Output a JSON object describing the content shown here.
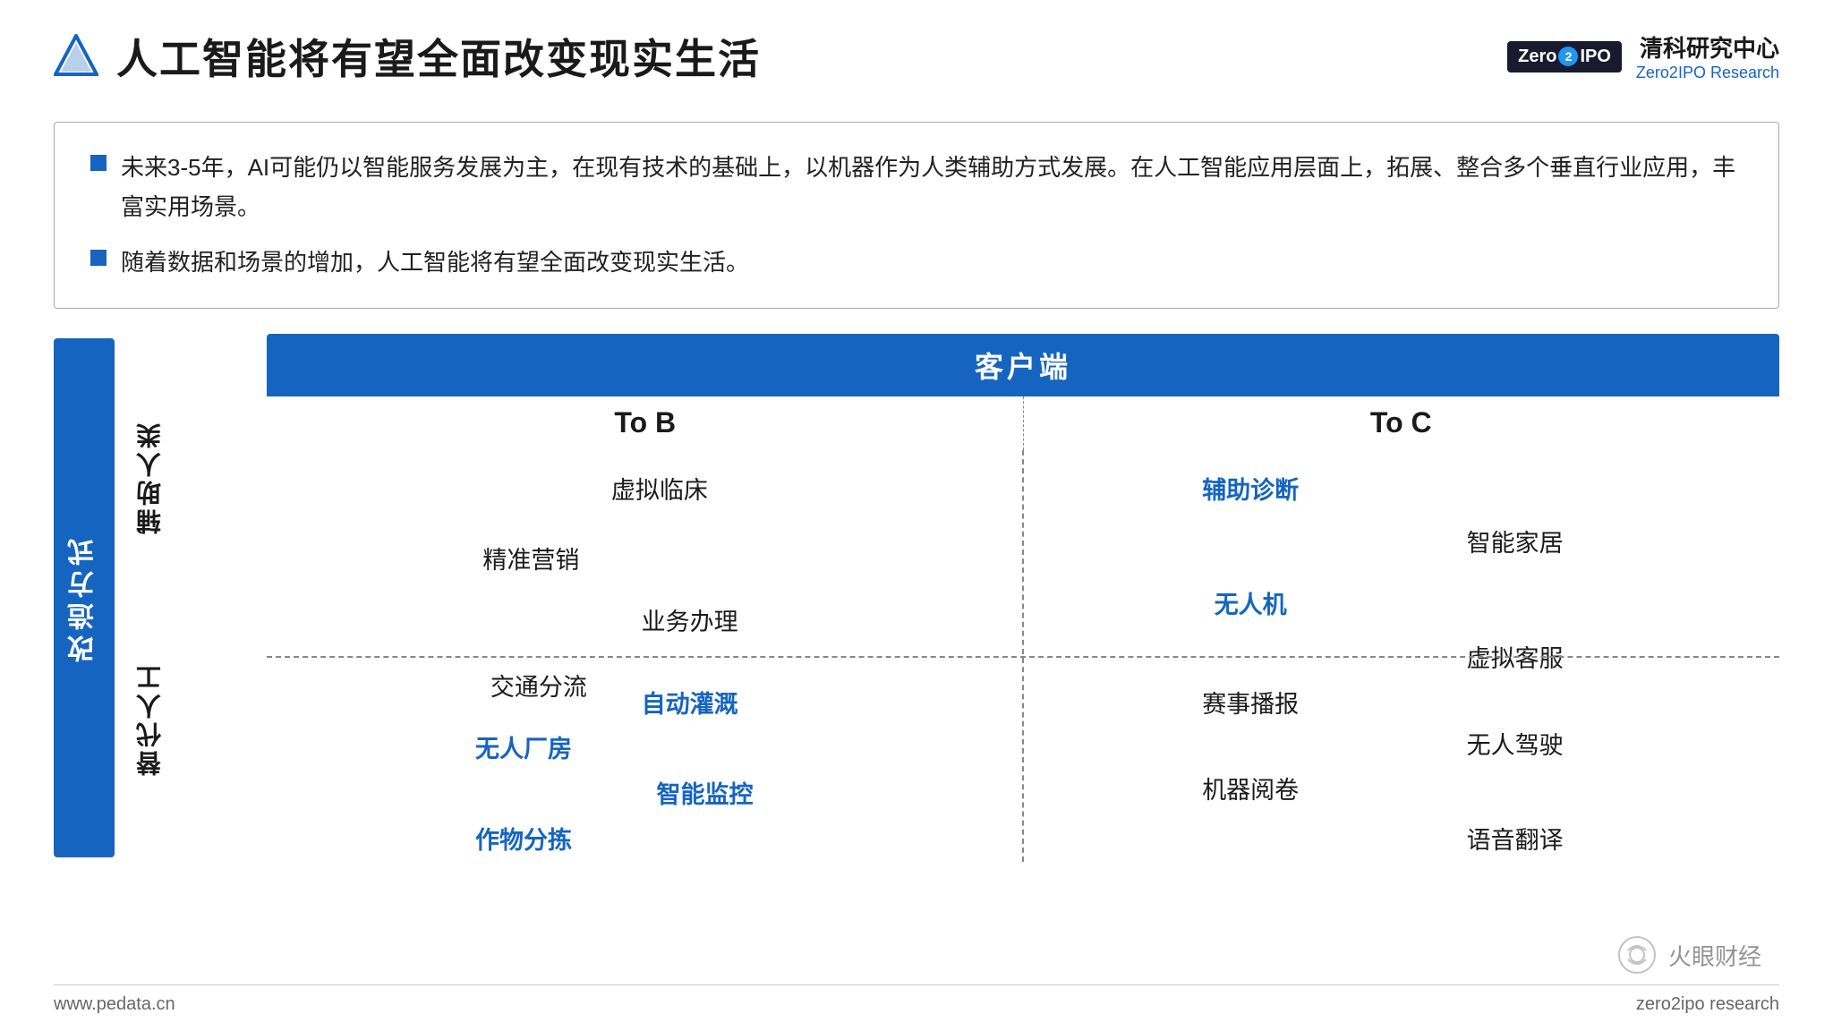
{
  "header": {
    "title": "人工智能将有望全面改变现实生活",
    "logo_text": "Zero2IPO",
    "org_cn": "清科研究中心",
    "org_en": "Zero2IPO Research"
  },
  "bullets": [
    "未来3-5年，AI可能仍以智能服务发展为主，在现有技术的基础上，以机器作为人类辅助方式发展。在人工智能应用层面上，拓展、整合多个垂直行业应用，丰富实用场景。",
    "随着数据和场景的增加，人工智能将有望全面改变现实生活。"
  ],
  "matrix": {
    "customer_header": "客户端",
    "left_axis_label": "改造方式",
    "row_labels": [
      "辅助人类",
      "替代人工"
    ],
    "col_labels": [
      "To  B",
      "To  C"
    ],
    "items": {
      "top_left": [
        {
          "text": "虚拟临床",
          "left": "52%",
          "top": "6%",
          "blue": false
        },
        {
          "text": "精准营销",
          "left": "32%",
          "top": "22%",
          "blue": false
        },
        {
          "text": "业务办理",
          "left": "55%",
          "top": "38%",
          "blue": false
        },
        {
          "text": "交通分流",
          "left": "38%",
          "top": "54%",
          "blue": false
        }
      ],
      "top_right": [
        {
          "text": "辅助诊断",
          "left": "28%",
          "top": "6%",
          "blue": true
        },
        {
          "text": "智能家居",
          "left": "60%",
          "top": "19%",
          "blue": false
        },
        {
          "text": "无人机",
          "left": "28%",
          "top": "33%",
          "blue": true
        },
        {
          "text": "虚拟客服",
          "left": "62%",
          "top": "47%",
          "blue": false
        }
      ],
      "bottom_left": [
        {
          "text": "自动灌溉",
          "left": "55%",
          "top": "8%",
          "blue": true
        },
        {
          "text": "无人厂房",
          "left": "33%",
          "top": "26%",
          "blue": true
        },
        {
          "text": "智能监控",
          "left": "55%",
          "top": "47%",
          "blue": true
        },
        {
          "text": "作物分拣",
          "left": "33%",
          "top": "67%",
          "blue": true
        }
      ],
      "bottom_right": [
        {
          "text": "赛事播报",
          "left": "28%",
          "top": "8%",
          "blue": false
        },
        {
          "text": "无人驾驶",
          "left": "62%",
          "top": "22%",
          "blue": false
        },
        {
          "text": "机器阅卷",
          "left": "28%",
          "top": "43%",
          "blue": false
        },
        {
          "text": "语音翻译",
          "left": "62%",
          "top": "62%",
          "blue": false
        }
      ]
    }
  },
  "footer": {
    "left": "www.pedata.cn",
    "right": "zero2ipo research"
  },
  "watermark": "火眼财经"
}
